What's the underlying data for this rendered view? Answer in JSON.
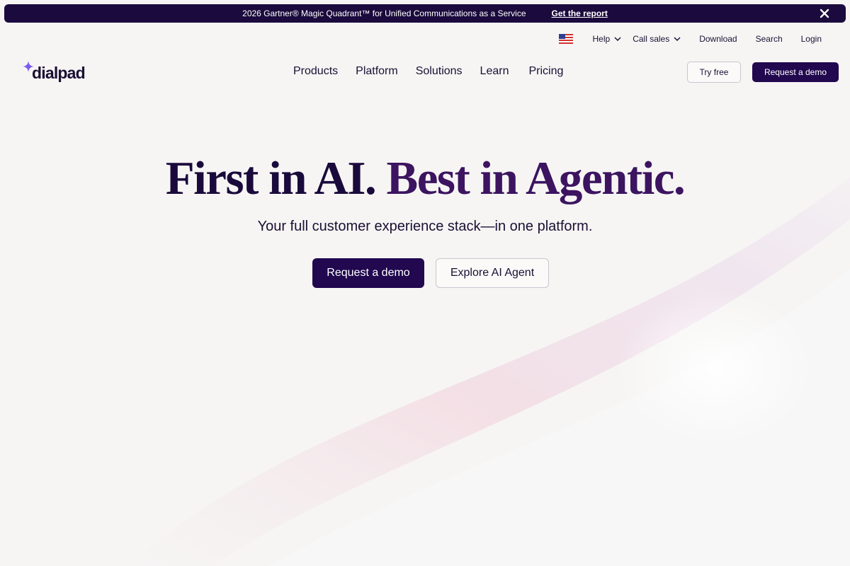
{
  "announcement": {
    "message": "2026 Gartner® Magic Quadrant™ for Unified Communications as a Service",
    "link_label": "Get the report",
    "close_icon": "close-icon"
  },
  "utility_nav": {
    "flag_icon": "us-flag-icon",
    "help": "Help",
    "call_sales": "Call sales",
    "download": "Download",
    "search": "Search",
    "login": "Login"
  },
  "brand": {
    "name": "dialpad",
    "accent": "#7b5cf0"
  },
  "main_nav": {
    "items": [
      "Products",
      "Platform",
      "Solutions",
      "Learn",
      "Pricing"
    ]
  },
  "header_actions": {
    "try_free": "Try free",
    "request_demo": "Request a demo"
  },
  "hero": {
    "title_part1": "First in AI.",
    "title_part2": "Best in Agentic.",
    "subtitle": "Your full customer experience stack—in one platform.",
    "primary_cta": "Request a demo",
    "secondary_cta": "Explore AI Agent"
  },
  "colors": {
    "navy": "#21084f",
    "background": "#f6f5f4",
    "text": "#1a1033"
  }
}
